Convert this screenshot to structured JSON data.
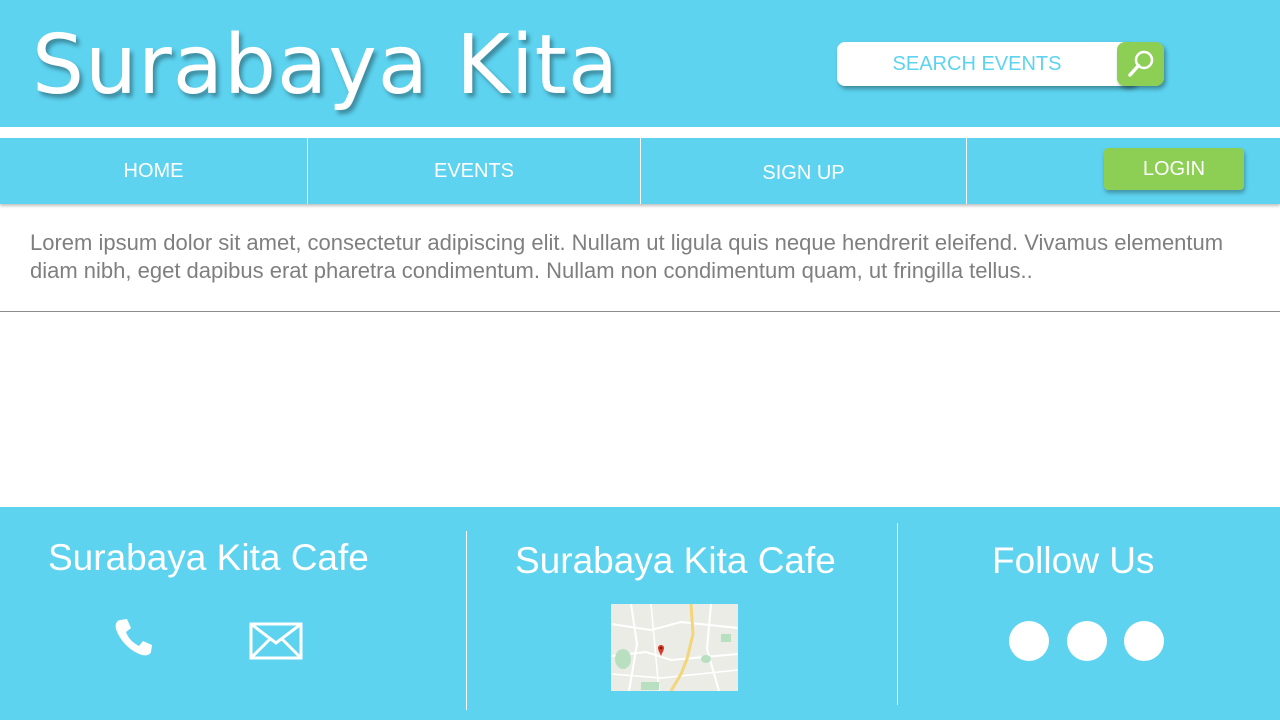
{
  "header": {
    "site_title": "Surabaya Kita",
    "search": {
      "placeholder": "SEARCH EVENTS",
      "button_icon": "search-icon"
    }
  },
  "nav": {
    "items": [
      {
        "label": "HOME"
      },
      {
        "label": "EVENTS"
      },
      {
        "label": "SIGN UP"
      }
    ],
    "login_label": "LOGIN"
  },
  "main": {
    "intro_text": "Lorem ipsum dolor sit amet, consectetur adipiscing elit. Nullam ut ligula quis neque hendrerit eleifend. Vivamus elementum diam nibh, eget dapibus erat pharetra condimentum. Nullam non condimentum quam, ut fringilla tellus.."
  },
  "footer": {
    "contact": {
      "heading": "Surabaya Kita Cafe",
      "icons": [
        "phone-icon",
        "mail-icon"
      ]
    },
    "location": {
      "heading": "Surabaya Kita Cafe",
      "map_icon": "map-pin-icon"
    },
    "social": {
      "heading": "Follow Us",
      "count": 3
    }
  },
  "colors": {
    "primary": "#5dd3f0",
    "accent": "#8dcf55",
    "text_muted": "#7f7f7f",
    "white": "#ffffff"
  }
}
